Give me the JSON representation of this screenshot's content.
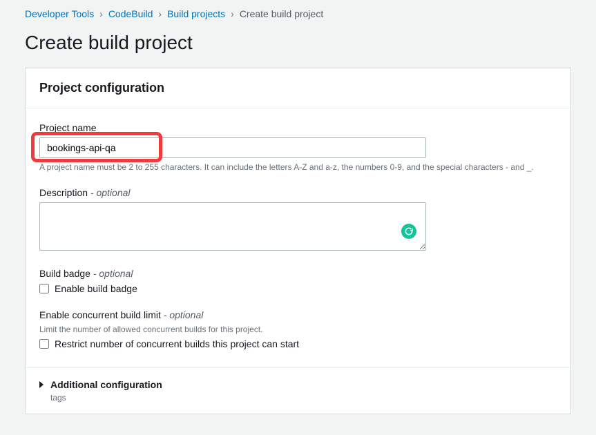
{
  "breadcrumb": {
    "items": [
      {
        "label": "Developer Tools",
        "link": true
      },
      {
        "label": "CodeBuild",
        "link": true
      },
      {
        "label": "Build projects",
        "link": true
      },
      {
        "label": "Create build project",
        "link": false
      }
    ]
  },
  "page": {
    "title": "Create build project"
  },
  "panel": {
    "title": "Project configuration",
    "projectName": {
      "label": "Project name",
      "value": "bookings-api-qa",
      "hint": "A project name must be 2 to 255 characters. It can include the letters A-Z and a-z, the numbers 0-9, and the special characters - and _."
    },
    "description": {
      "label": "Description",
      "optional": "- optional",
      "value": ""
    },
    "buildBadge": {
      "label": "Build badge",
      "optional": "- optional",
      "checkbox": "Enable build badge",
      "checked": false
    },
    "concurrent": {
      "label": "Enable concurrent build limit",
      "optional": "- optional",
      "hint": "Limit the number of allowed concurrent builds for this project.",
      "checkbox": "Restrict number of concurrent builds this project can start",
      "checked": false
    },
    "additional": {
      "title": "Additional configuration",
      "sub": "tags"
    }
  }
}
